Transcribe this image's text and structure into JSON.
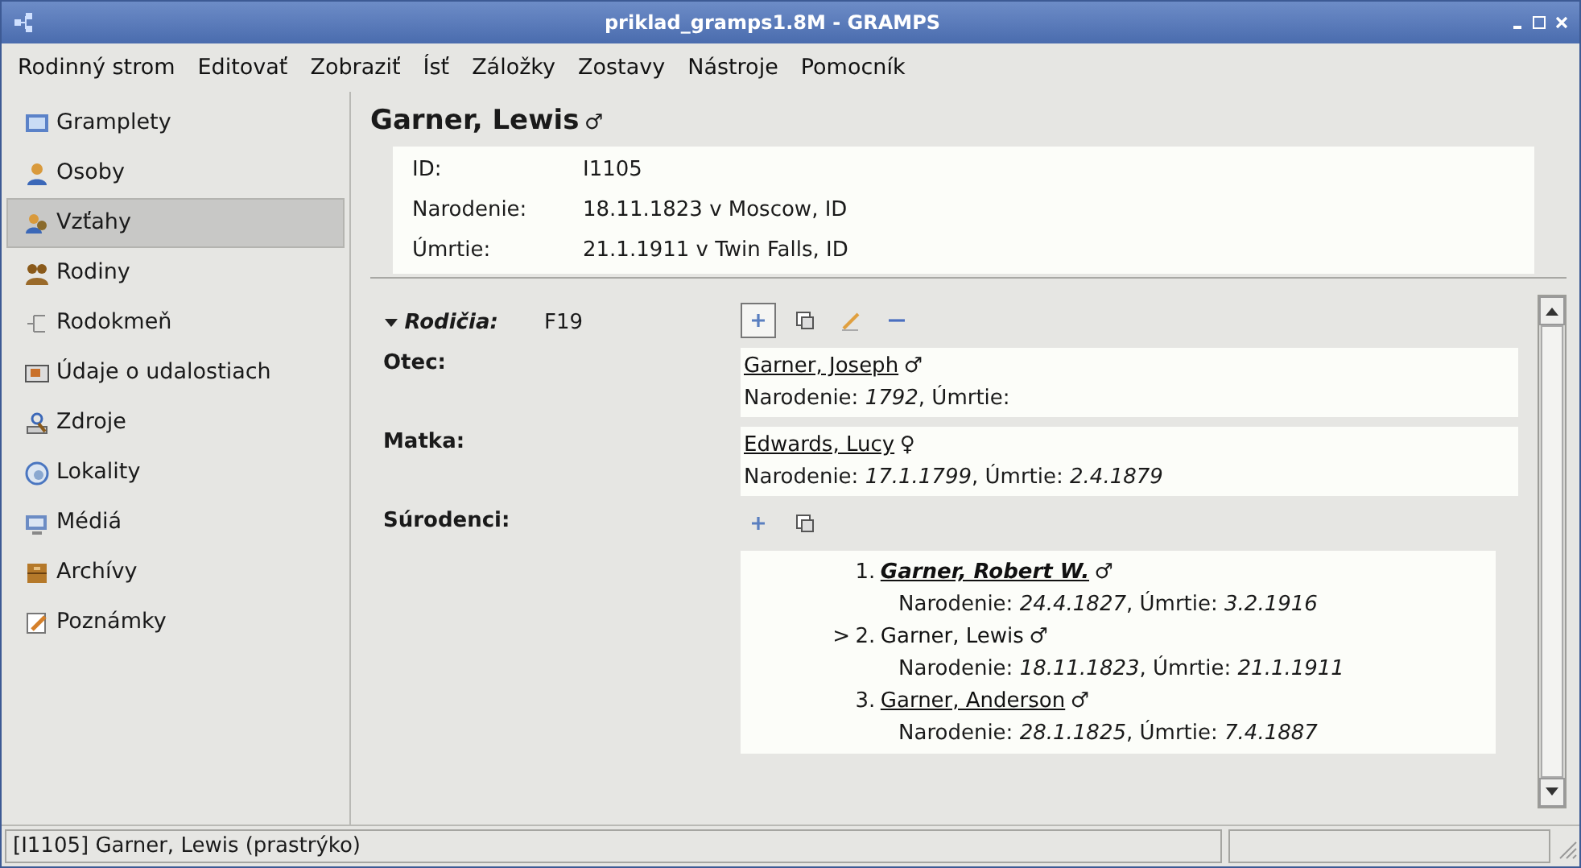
{
  "window": {
    "title": "priklad_gramps1.8M - GRAMPS"
  },
  "menu": [
    "Rodinný strom",
    "Editovať",
    "Zobraziť",
    "Ísť",
    "Záložky",
    "Zostavy",
    "Nástroje",
    "Pomocník"
  ],
  "sidebar": {
    "items": [
      {
        "label": "Gramplety",
        "kind": "gramplets",
        "selected": false
      },
      {
        "label": "Osoby",
        "kind": "people",
        "selected": false
      },
      {
        "label": "Vzťahy",
        "kind": "relations",
        "selected": true
      },
      {
        "label": "Rodiny",
        "kind": "families",
        "selected": false
      },
      {
        "label": "Rodokmeň",
        "kind": "pedigree",
        "selected": false
      },
      {
        "label": "Údaje o udalostiach",
        "kind": "events",
        "selected": false
      },
      {
        "label": "Zdroje",
        "kind": "sources",
        "selected": false
      },
      {
        "label": "Lokality",
        "kind": "places",
        "selected": false
      },
      {
        "label": "Médiá",
        "kind": "media",
        "selected": false
      },
      {
        "label": "Archívy",
        "kind": "repositories",
        "selected": false
      },
      {
        "label": "Poznámky",
        "kind": "notes",
        "selected": false
      }
    ]
  },
  "person": {
    "name": "Garner, Lewis",
    "gender": "♂",
    "facts": [
      {
        "label": "ID:",
        "value": "I1105"
      },
      {
        "label": "Narodenie:",
        "value": "18.11.1823 v Moscow, ID"
      },
      {
        "label": "Úmrtie:",
        "value": "21.1.1911 v Twin Falls, ID"
      }
    ]
  },
  "parents": {
    "expanded": true,
    "label": "Rodičia:",
    "family_id": "F19",
    "members": [
      {
        "role": "Otec:",
        "name": "Garner, Joseph",
        "gender": "♂",
        "dates": "Narodenie: *1792*, Úmrtie:"
      },
      {
        "role": "Matka:",
        "name": "Edwards, Lucy",
        "gender": "♀",
        "dates": "Narodenie: *17.1.1799*, Úmrtie: *2.4.1879*"
      }
    ],
    "siblings_label": "Súrodenci:",
    "siblings": [
      {
        "number": "1.",
        "name": "Garner, Robert W.",
        "gender": "♂",
        "emphasized": true,
        "is_link": true,
        "dates": "Narodenie: *24.4.1827*, Úmrtie: *3.2.1916*"
      },
      {
        "marker": ">",
        "number": "2.",
        "name": "Garner, Lewis",
        "gender": "♂",
        "emphasized": false,
        "is_link": false,
        "dates": "Narodenie: *18.11.1823*, Úmrtie: *21.1.1911*"
      },
      {
        "number": "3.",
        "name": "Garner, Anderson",
        "gender": "♂",
        "emphasized": false,
        "is_link": true,
        "dates": "Narodenie: *28.1.1825*, Úmrtie: *7.4.1887*"
      }
    ]
  },
  "status_bar": {
    "text": "[I1105] Garner, Lewis (prastrýko)"
  }
}
